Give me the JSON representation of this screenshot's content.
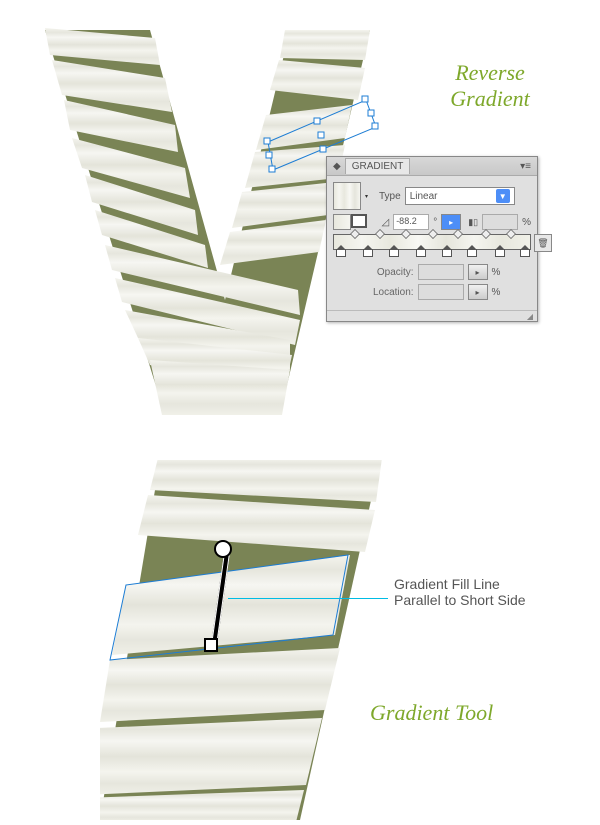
{
  "titles": {
    "reverse_gradient_l1": "Reverse",
    "reverse_gradient_l2": "Gradient",
    "gradient_tool": "Gradient Tool"
  },
  "panel": {
    "tab": "GRADIENT",
    "type_label": "Type",
    "type_value": "Linear",
    "angle_value": "-88.2",
    "angle_unit": "°",
    "opacity_label": "Opacity:",
    "opacity_unit": "%",
    "location_label": "Location:",
    "location_unit": "%",
    "ratio_unit": "%"
  },
  "annotation": {
    "line1": "Gradient Fill Line",
    "line2": "Parallel to Short Side"
  }
}
